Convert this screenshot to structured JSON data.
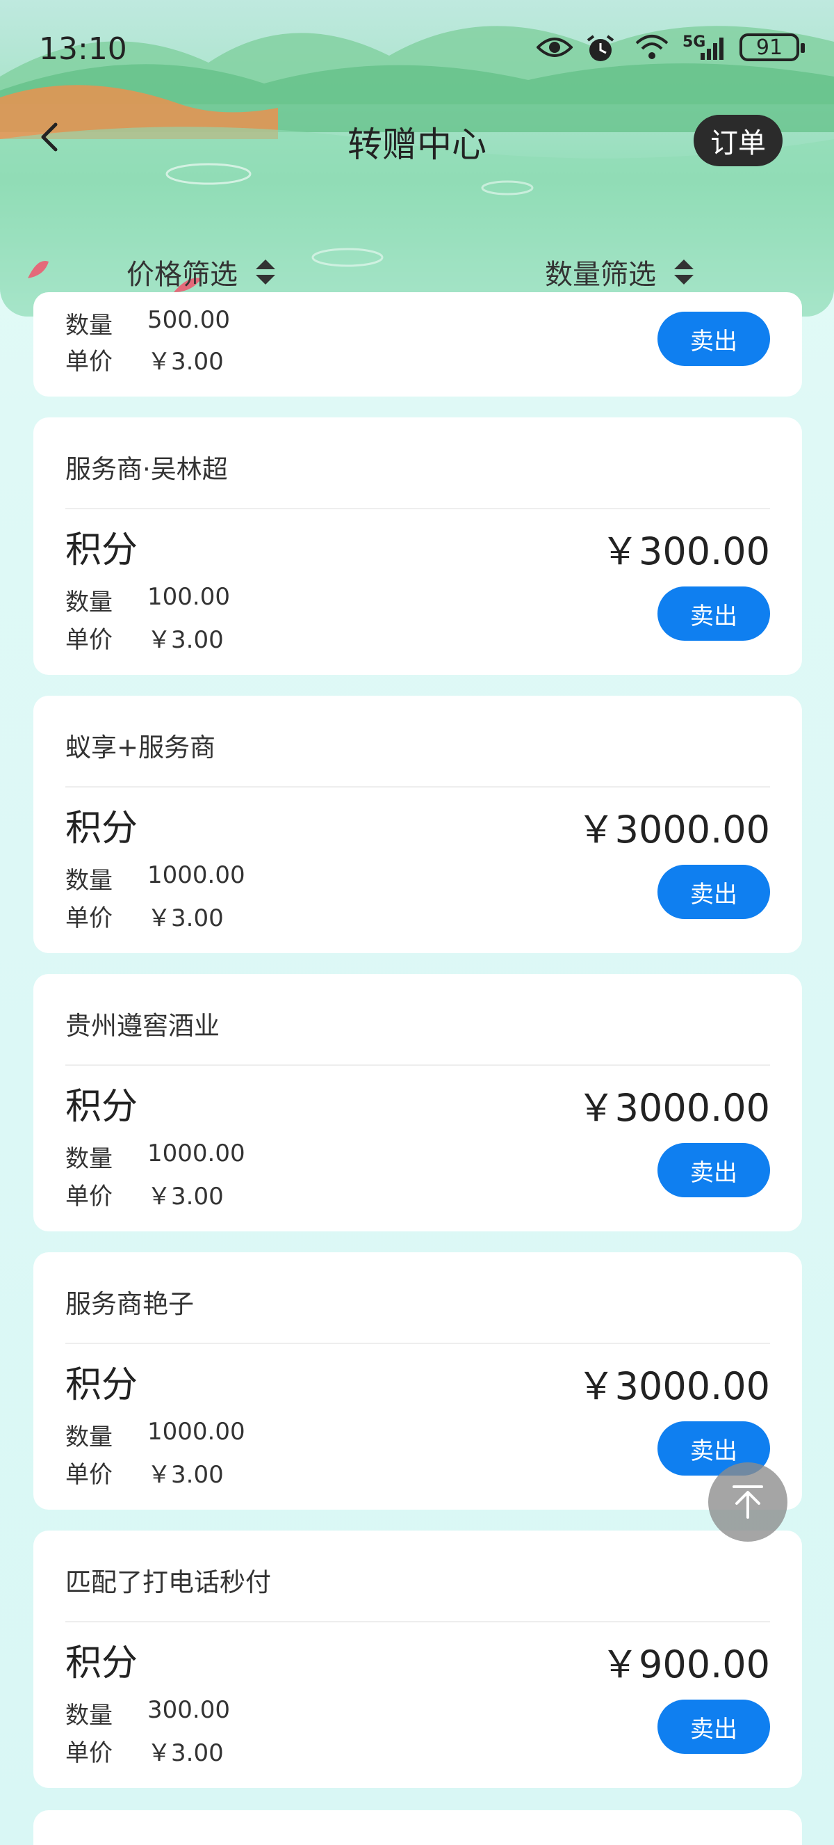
{
  "status_bar": {
    "time": "13:10",
    "network": "5G",
    "battery": "91",
    "icons": [
      "eye-icon",
      "alarm-icon",
      "wifi-icon",
      "signal-icon",
      "battery-icon"
    ]
  },
  "nav": {
    "title": "转赠中心",
    "order_label": "订单"
  },
  "filters": {
    "price_label": "价格筛选",
    "quantity_label": "数量筛选"
  },
  "labels": {
    "quantity": "数量",
    "unit_price": "单价",
    "sell": "卖出"
  },
  "partial_top": {
    "quantity": "500.00",
    "unit_price": "￥3.00"
  },
  "listings": [
    {
      "seller": "服务商·吴林超",
      "kind": "积分",
      "total": "￥300.00",
      "quantity": "100.00",
      "unit_price": "￥3.00"
    },
    {
      "seller": "蚁享+服务商",
      "kind": "积分",
      "total": "￥3000.00",
      "quantity": "1000.00",
      "unit_price": "￥3.00"
    },
    {
      "seller": "贵州遵窖酒业",
      "kind": "积分",
      "total": "￥3000.00",
      "quantity": "1000.00",
      "unit_price": "￥3.00"
    },
    {
      "seller": "服务商艳子",
      "kind": "积分",
      "total": "￥3000.00",
      "quantity": "1000.00",
      "unit_price": "￥3.00"
    },
    {
      "seller": "匹配了打电话秒付",
      "kind": "积分",
      "total": "￥900.00",
      "quantity": "300.00",
      "unit_price": "￥3.00"
    }
  ],
  "colors": {
    "accent": "#0f7ff0",
    "order_button": "#2b2b2b",
    "background": "#dff9f6"
  }
}
